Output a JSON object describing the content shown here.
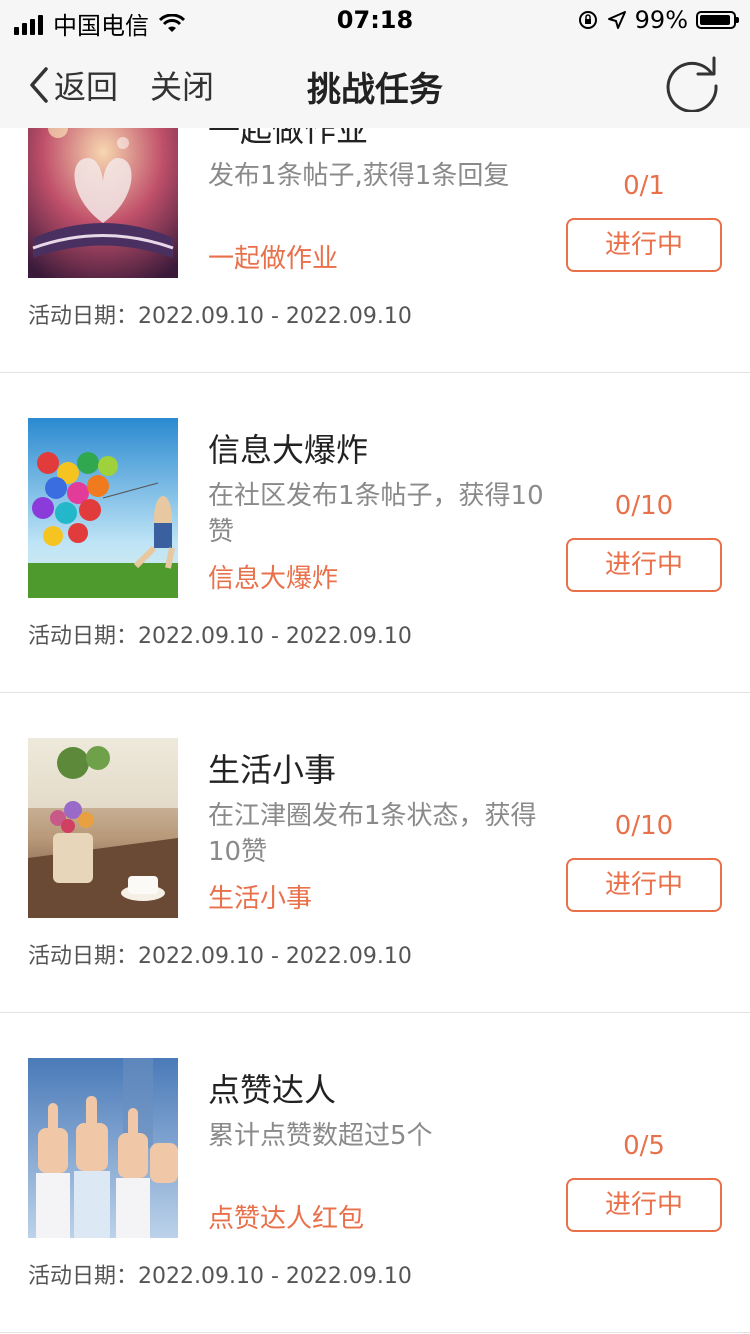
{
  "status_bar": {
    "carrier": "中国电信",
    "time": "07:18",
    "battery_percent": "99%"
  },
  "nav": {
    "back_label": "返回",
    "close_label": "关闭",
    "title": "挑战任务",
    "refresh_icon": "refresh-icon"
  },
  "date_label": "活动日期：",
  "tasks": [
    {
      "title": "一起做作业",
      "description": "发布1条帖子,获得1条回复",
      "reward": "一起做作业",
      "progress": "0/1",
      "status": "进行中",
      "dates": "2022.09.10 - 2022.09.10",
      "image": "heart-shaped-book-pages"
    },
    {
      "title": "信息大爆炸",
      "description": "在社区发布1条帖子，获得10赞",
      "reward": "信息大爆炸",
      "progress": "0/10",
      "status": "进行中",
      "dates": "2022.09.10 - 2022.09.10",
      "image": "child-with-balloons"
    },
    {
      "title": "生活小事",
      "description": "在江津圈发布1条状态，获得10赞",
      "reward": "生活小事",
      "progress": "0/10",
      "status": "进行中",
      "dates": "2022.09.10 - 2022.09.10",
      "image": "flower-pot-and-coffee"
    },
    {
      "title": "点赞达人",
      "description": "累计点赞数超过5个",
      "reward": "点赞达人红包",
      "progress": "0/5",
      "status": "进行中",
      "dates": "2022.09.10 - 2022.09.10",
      "image": "thumbs-up-hands"
    }
  ],
  "colors": {
    "accent": "#e8704a",
    "nav_background": "#f6f6f6"
  }
}
